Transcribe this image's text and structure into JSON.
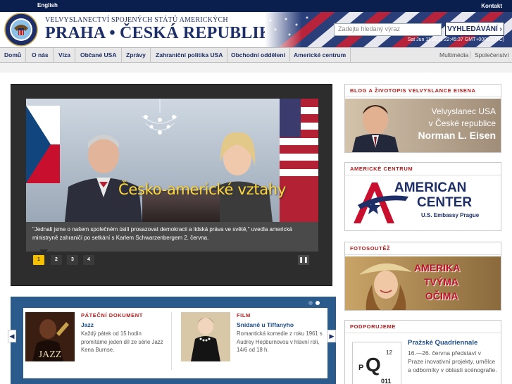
{
  "topbar": {
    "language_link": "English",
    "contact_link": "Kontakt"
  },
  "header": {
    "embassy_line": "VELVYSLANECTVÍ SPOJENÝCH STÁTŮ AMERICKÝCH",
    "embassy_title": "PRAHA • ČESKÁ REPUBLIKA",
    "search_placeholder": "Zadejte hledaný výraz",
    "search_button": "VYHLEDÁVÁNÍ ›",
    "datetime": "Sat Jun 11 2011 22:45:37 GMT+0000 (UTC)"
  },
  "nav": {
    "items": [
      "Domů",
      "O nás",
      "Víza",
      "Občané USA",
      "Zprávy",
      "Zahraniční politika USA",
      "Obchodní oddělení",
      "Americké centrum"
    ],
    "right_items": [
      "Multimédia",
      "Společenství"
    ]
  },
  "slideshow": {
    "title": "Česko-americké vztahy",
    "caption": "\"Jednali jsme o našem společném úsilí prosazovat demokracii a lidská práva ve světě,\" uvedla americká ministryně zahraničí po setkání s Karlem Schwarzenbergem 2. června.",
    "dots": [
      "1",
      "2",
      "3",
      "4"
    ],
    "active_dot": 1,
    "pause_icon": "pause-icon"
  },
  "carousel": {
    "prev_icon": "chevron-left-icon",
    "next_icon": "chevron-right-icon",
    "cards": [
      {
        "kicker": "PÁTEČNÍ DOKUMENT",
        "title": "Jazz",
        "text": "Každý pátek od 15 hodin promítáme jeden díl ze série Jazz Kena Burnse.",
        "thumb_word": "JAZZ"
      },
      {
        "kicker": "FILM",
        "title": "Snídaně u Tiffanyho",
        "text": "Romantická komedie z roku 1961 s Audrey Hepburnovou v hlavní roli, 14/6 od 18 h."
      }
    ]
  },
  "sidebar": {
    "blog": {
      "heading": "BLOG A ŽIVOTOPIS VELVYSLANCE EISENA",
      "line1": "Velvyslanec USA",
      "line2": "v České republice",
      "line3": "Norman L. Eisen"
    },
    "center": {
      "heading": "AMERICKÉ CENTRUM",
      "line1": "AMERICAN",
      "line2": "CENTER",
      "line3": "U.S. Embassy Prague"
    },
    "photo": {
      "heading": "FOTOSOUTĚŽ",
      "line1": "AMERIKA",
      "line2": "TVÝMA",
      "line3": "OČIMA"
    },
    "support": {
      "heading": "PODPORUJEME",
      "title": "Pražské Quadriennale",
      "text": "16.—26. června představí v Praze inovativní projekty, umělce a odborníky v oblasti scénografie.",
      "logo_letters": [
        "P",
        "Q",
        "12",
        "011"
      ]
    }
  },
  "colors": {
    "navy": "#1d2f66",
    "accent_red": "#b61a1a",
    "slide_title": "#ffd740",
    "active_dot": "#f5c000"
  }
}
